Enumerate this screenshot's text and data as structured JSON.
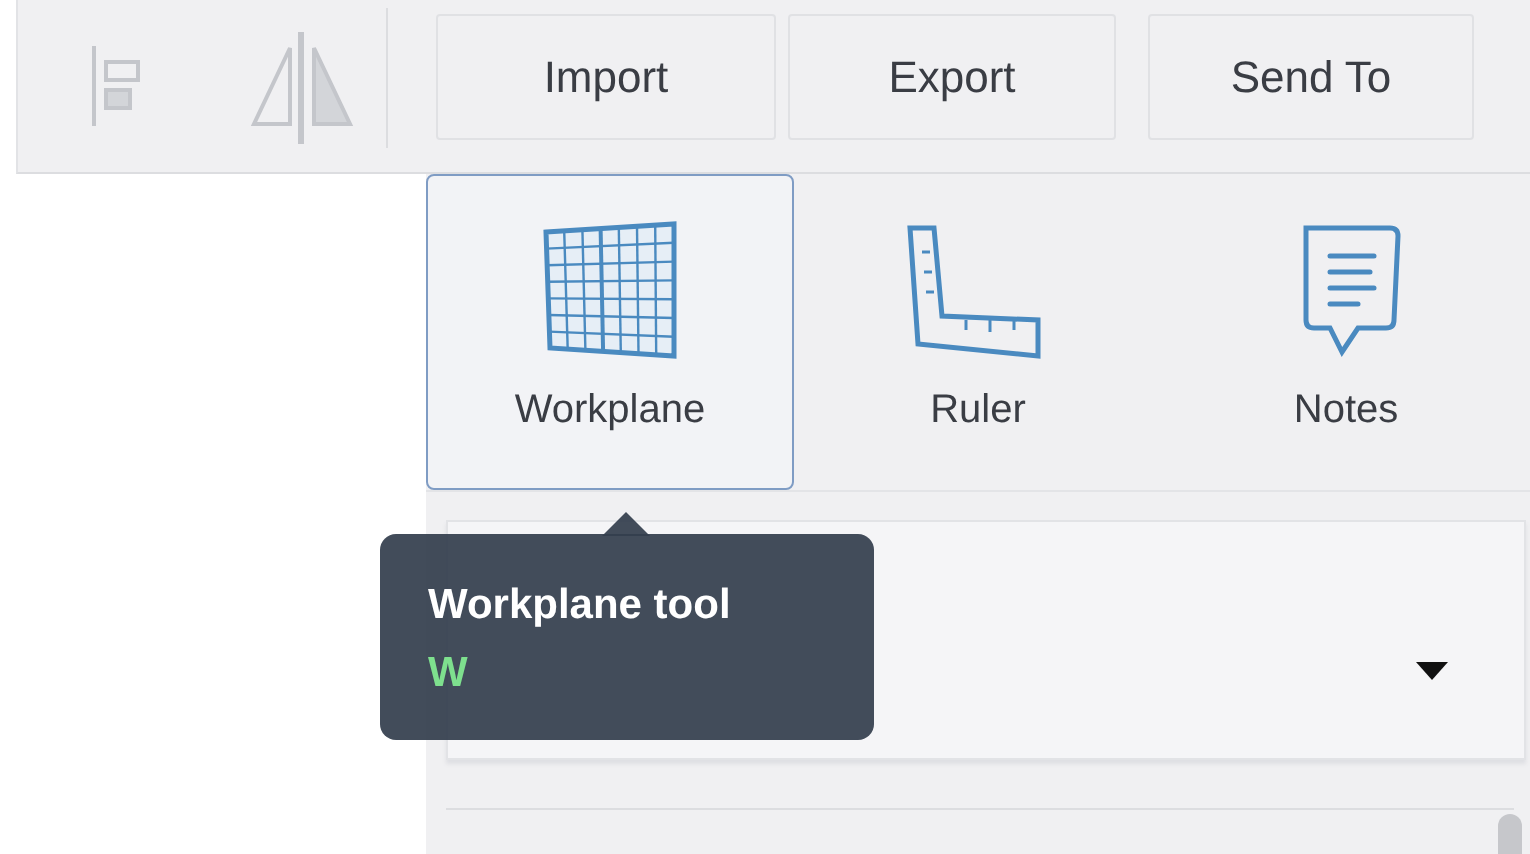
{
  "toolbar": {
    "buttons": [
      {
        "label": "Import"
      },
      {
        "label": "Export"
      },
      {
        "label": "Send To"
      }
    ]
  },
  "tools": [
    {
      "kind": "workplane",
      "label": "Workplane",
      "selected": true
    },
    {
      "kind": "ruler",
      "label": "Ruler",
      "selected": false
    },
    {
      "kind": "notes",
      "label": "Notes",
      "selected": false
    }
  ],
  "tooltip": {
    "title": "Workplane tool",
    "shortcut": "W"
  }
}
